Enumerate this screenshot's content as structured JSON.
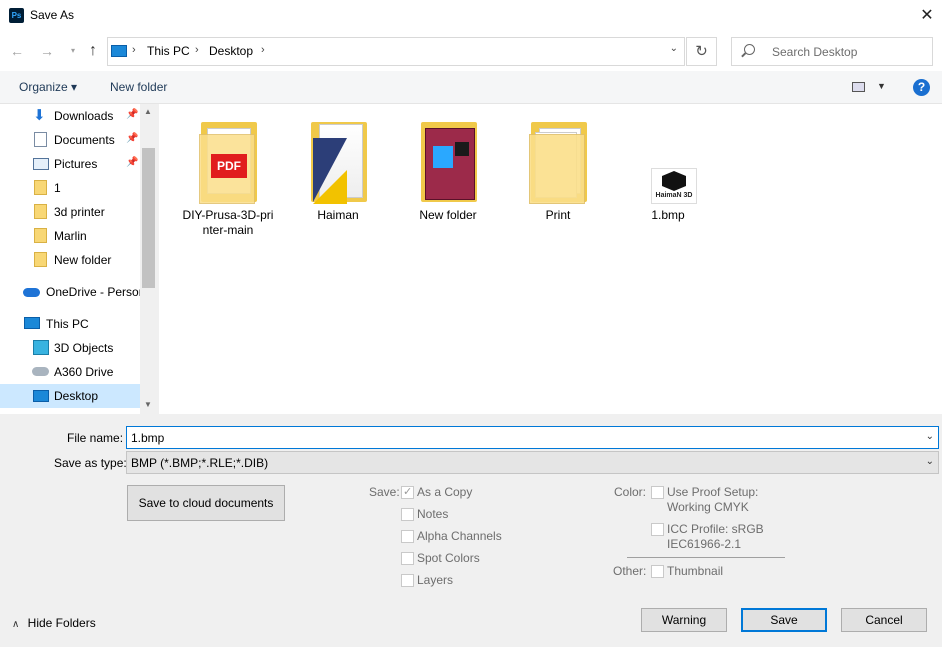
{
  "window": {
    "title": "Save As",
    "app_icon_text": "Ps"
  },
  "nav": {
    "breadcrumb": [
      "This PC",
      "Desktop"
    ],
    "search_placeholder": "Search Desktop"
  },
  "toolbar": {
    "organize": "Organize ▾",
    "new_folder": "New folder"
  },
  "sidebar": {
    "items": [
      {
        "label": "Downloads",
        "icon": "download-arrow-icon",
        "pinned": true
      },
      {
        "label": "Documents",
        "icon": "document-icon",
        "pinned": true
      },
      {
        "label": "Pictures",
        "icon": "pictures-icon",
        "pinned": true
      },
      {
        "label": "1",
        "icon": "folder-icon"
      },
      {
        "label": "3d printer",
        "icon": "folder-icon"
      },
      {
        "label": "Marlin",
        "icon": "folder-icon"
      },
      {
        "label": "New folder",
        "icon": "folder-icon"
      },
      {
        "label": "OneDrive - Persor",
        "icon": "cloud-icon"
      },
      {
        "label": "This PC",
        "icon": "computer-icon"
      },
      {
        "label": "3D Objects",
        "icon": "cube-icon"
      },
      {
        "label": "A360 Drive",
        "icon": "drive-icon"
      },
      {
        "label": "Desktop",
        "icon": "desktop-icon",
        "selected": true
      }
    ]
  },
  "files": [
    {
      "name": "DIY-Prusa-3D-pri nter-main",
      "line1": "DIY-Prusa-3D-pri",
      "line2": "nter-main",
      "type": "folder",
      "overlay": "PDF"
    },
    {
      "name": "Haiman",
      "line1": "Haiman",
      "type": "folder"
    },
    {
      "name": "New folder",
      "line1": "New folder",
      "type": "folder"
    },
    {
      "name": "Print",
      "line1": "Print",
      "type": "folder"
    },
    {
      "name": "1.bmp",
      "line1": "1.bmp",
      "type": "image",
      "thumb_text": "HaimaN 3D"
    }
  ],
  "save_form": {
    "file_name_label": "File name:",
    "file_name_value": "1.bmp",
    "save_as_type_label": "Save as type:",
    "save_as_type_value": "BMP (*.BMP;*.RLE;*.DIB)",
    "cloud_button": "Save to cloud documents",
    "save_label": "Save:",
    "save_options": [
      {
        "label": "As a Copy",
        "checked": true
      },
      {
        "label": "Notes",
        "checked": false
      },
      {
        "label": "Alpha Channels",
        "checked": false
      },
      {
        "label": "Spot Colors",
        "checked": false
      },
      {
        "label": "Layers",
        "checked": false
      }
    ],
    "color_label": "Color:",
    "proof_setup_line1": "Use Proof Setup:",
    "proof_setup_line2": "Working CMYK",
    "icc_line1": "ICC Profile:  sRGB",
    "icc_line2": "IEC61966-2.1",
    "other_label": "Other:",
    "thumbnail_label": "Thumbnail"
  },
  "footer": {
    "hide_folders": "Hide Folders",
    "warning": "Warning",
    "save": "Save",
    "cancel": "Cancel"
  }
}
